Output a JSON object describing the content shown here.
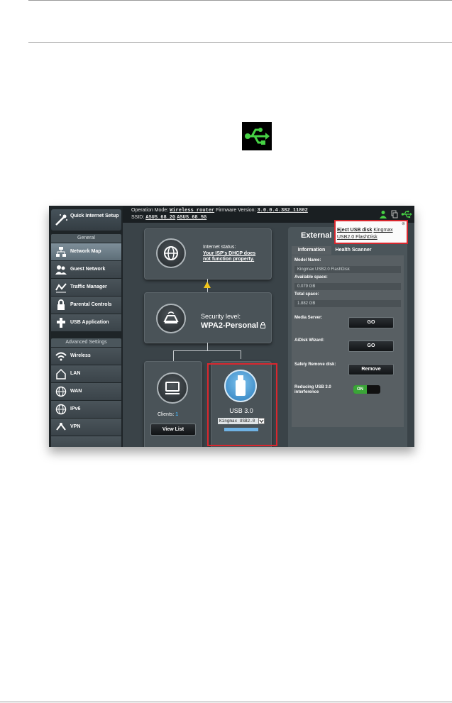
{
  "colors": {
    "accent_green": "#46d144",
    "highlight_red": "#d9272e",
    "sidebar_bg": "#1e2427"
  },
  "sidebar": {
    "quick_setup": "Quick Internet Setup",
    "general_header": "General",
    "general_items": [
      {
        "label": "Network Map",
        "icon": "network-map-icon",
        "active": true
      },
      {
        "label": "Guest Network",
        "icon": "guest-network-icon",
        "active": false
      },
      {
        "label": "Traffic Manager",
        "icon": "traffic-manager-icon",
        "active": false
      },
      {
        "label": "Parental Controls",
        "icon": "parental-controls-icon",
        "active": false
      },
      {
        "label": "USB Application",
        "icon": "usb-application-icon",
        "active": false
      }
    ],
    "advanced_header": "Advanced Settings",
    "advanced_items": [
      {
        "label": "Wireless",
        "icon": "wireless-icon"
      },
      {
        "label": "LAN",
        "icon": "lan-icon"
      },
      {
        "label": "WAN",
        "icon": "wan-icon"
      },
      {
        "label": "IPv6",
        "icon": "ipv6-icon"
      },
      {
        "label": "VPN",
        "icon": "vpn-icon"
      }
    ]
  },
  "topbar": {
    "operation_mode_label": "Operation Mode:",
    "operation_mode_value": "Wireless router",
    "firmware_label": "Firmware Version:",
    "firmware_value": "3.0.0.4.382_11802",
    "ssid_label": "SSID:",
    "ssid_2g": "ASUS_68_2G",
    "ssid_5g": "ASUS_68_5G"
  },
  "network_map": {
    "internet_status_label": "Internet status:",
    "internet_status_value": "Your ISP's DHCP does not function property.",
    "security_label": "Security level:",
    "security_value": "WPA2-Personal",
    "clients_label": "Clients:",
    "clients_count": "1",
    "view_list_button": "View List",
    "usb_label": "USB 3.0",
    "usb_select_value": "Kingmax USB2.0"
  },
  "panel": {
    "title": "External",
    "tabs": [
      "Information",
      "Health Scanner"
    ],
    "model_name_label": "Model Name:",
    "model_name_value": "Kingmax USB2.0 FlashDisk",
    "available_space_label": "Available space:",
    "available_space_value": "0.079 GB",
    "total_space_label": "Total space:",
    "total_space_value": "1.882 GB",
    "media_server_label": "Media Server:",
    "media_server_button": "GO",
    "aidisk_label": "AiDisk Wizard:",
    "aidisk_button": "GO",
    "safely_remove_label": "Safely Remove disk:",
    "remove_button": "Remove",
    "reducing_label": "Reducing USB 3.0 interference",
    "toggle_state": "ON"
  },
  "popup": {
    "eject_label": "Eject USB disk",
    "device_name_line1": "Kingmax",
    "device_name_line2": "USB2.0 FlashDisk"
  }
}
